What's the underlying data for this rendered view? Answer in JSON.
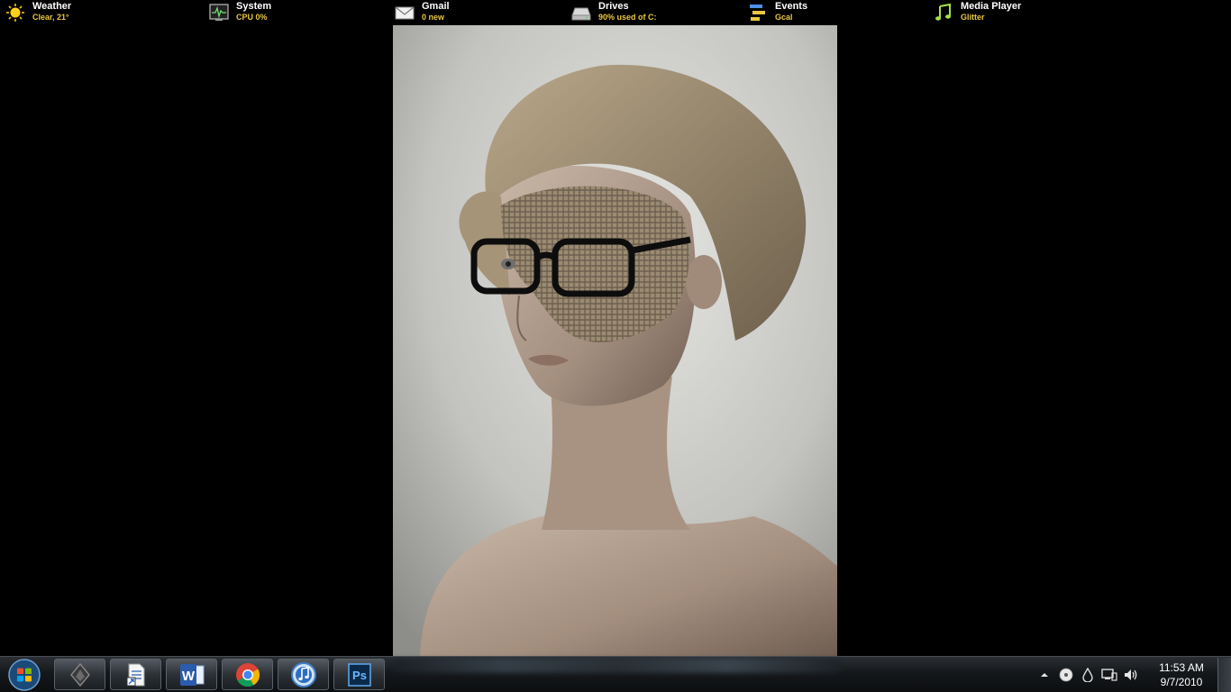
{
  "widgets": [
    {
      "title": "Weather",
      "subtitle": "Clear, 21°",
      "icon": "sun-icon"
    },
    {
      "title": "System",
      "subtitle": "CPU 0%",
      "icon": "system-monitor-icon"
    },
    {
      "title": "Gmail",
      "subtitle": "0 new",
      "icon": "mail-icon"
    },
    {
      "title": "Drives",
      "subtitle": "90% used of C:",
      "icon": "drive-icon"
    },
    {
      "title": "Events",
      "subtitle": "Gcal",
      "icon": "calendar-events-icon"
    },
    {
      "title": "Media Player",
      "subtitle": "Glitter",
      "icon": "music-note-icon"
    }
  ],
  "taskbar": {
    "pinned": [
      {
        "app": "Rocketdock",
        "icon": "rocket-launcher-icon"
      },
      {
        "app": "Document shortcut",
        "icon": "document-shortcut-icon"
      },
      {
        "app": "Microsoft Word",
        "icon": "word-icon"
      },
      {
        "app": "Google Chrome",
        "icon": "chrome-icon"
      },
      {
        "app": "iTunes",
        "icon": "itunes-icon"
      },
      {
        "app": "Photoshop",
        "icon": "photoshop-icon"
      }
    ],
    "word_letter": "W",
    "photoshop_letter": "Ps"
  },
  "tray": {
    "time": "11:53 AM",
    "date": "9/7/2010"
  },
  "colors": {
    "widget_title": "#ffffff",
    "widget_subtitle": "#e8c640",
    "desktop": "#000000"
  }
}
